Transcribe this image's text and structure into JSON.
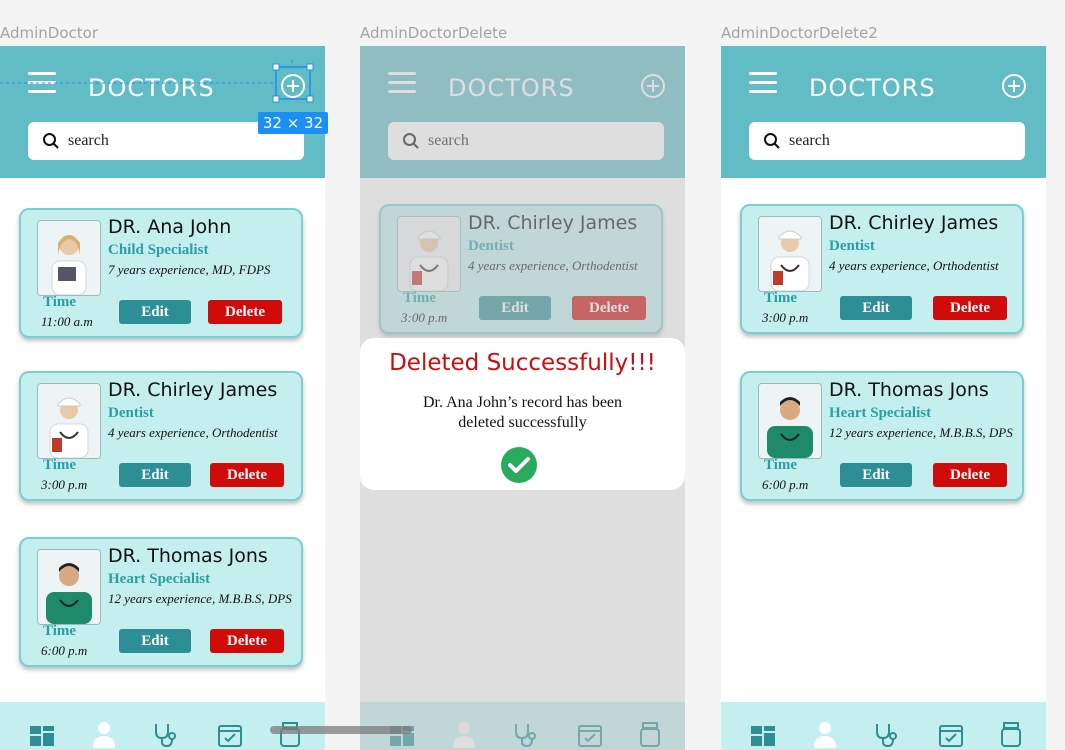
{
  "frames": [
    {
      "label": "AdminDoctor",
      "header_title": "DOCTORS",
      "search_placeholder": "search",
      "doctors": [
        {
          "name": "DR. Ana John",
          "specialty": "Child Specialist",
          "experience": "7 years experience, MD, FDPS",
          "time_label": "Time",
          "time": "11:00 a.m",
          "edit_label": "Edit",
          "delete_label": "Delete"
        },
        {
          "name": "DR. Chirley James",
          "specialty": "Dentist",
          "experience": "4 years experience, Orthodentist",
          "time_label": "Time",
          "time": "3:00 p.m",
          "edit_label": "Edit",
          "delete_label": "Delete"
        },
        {
          "name": "DR. Thomas Jons",
          "specialty": "Heart Specialist",
          "experience": "12 years experience, M.B.B.S, DPS",
          "time_label": "Time",
          "time": "6:00 p.m",
          "edit_label": "Edit",
          "delete_label": "Delete"
        }
      ]
    },
    {
      "label": "AdminDoctorDelete",
      "header_title": "DOCTORS",
      "search_placeholder": "search",
      "doctors": [
        {
          "name": "DR. Chirley James",
          "specialty": "Dentist",
          "experience": "4 years experience, Orthodentist",
          "time_label": "Time",
          "time": "3:00 p.m",
          "edit_label": "Edit",
          "delete_label": "Delete"
        }
      ],
      "modal": {
        "title": "Deleted Successfully!!!",
        "message": "Dr. Ana John’s record has been deleted successfully"
      }
    },
    {
      "label": "AdminDoctorDelete2",
      "header_title": "DOCTORS",
      "search_placeholder": "search",
      "doctors": [
        {
          "name": "DR. Chirley James",
          "specialty": "Dentist",
          "experience": "4 years experience, Orthodentist",
          "time_label": "Time",
          "time": "3:00 p.m",
          "edit_label": "Edit",
          "delete_label": "Delete"
        },
        {
          "name": "DR. Thomas Jons",
          "specialty": "Heart Specialist",
          "experience": "12 years experience, M.B.B.S, DPS",
          "time_label": "Time",
          "time": "6:00 p.m",
          "edit_label": "Edit",
          "delete_label": "Delete"
        }
      ]
    }
  ],
  "design_tool": {
    "size_badge": "32 × 32"
  },
  "bottom_nav_icons": [
    "dashboard-icon",
    "doctor-icon",
    "stethoscope-icon",
    "calendar-icon",
    "medicine-icon"
  ],
  "colors": {
    "header": "#62bcc5",
    "card_bg": "#c5efee",
    "card_border": "#78d0d2",
    "edit_button": "#2d8e96",
    "delete_button": "#d10a0a",
    "specialty_text": "#2a9ea6",
    "modal_title": "#cc0d0d",
    "success_green": "#2aaa5c",
    "selection_blue": "#1b8ff5"
  }
}
